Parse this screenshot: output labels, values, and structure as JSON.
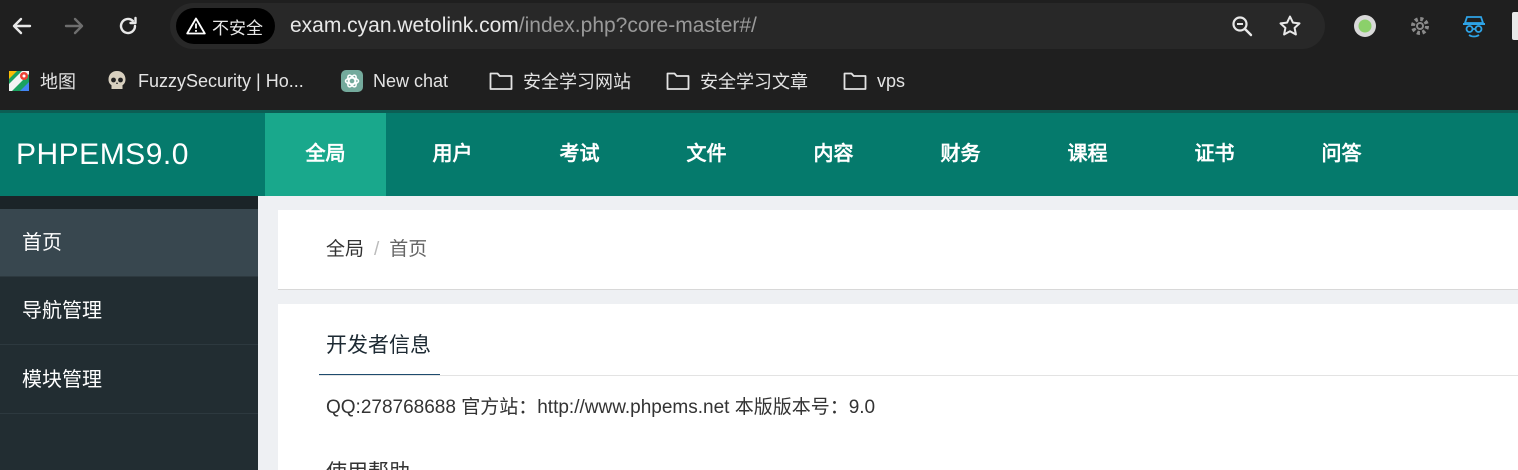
{
  "browser": {
    "security_label": "不安全",
    "url_host": "exam.cyan.wetolink.com",
    "url_rest": "/index.php?core-master#/"
  },
  "bookmarks": [
    {
      "label": "地图",
      "icon": "maps-icon"
    },
    {
      "label": "FuzzySecurity | Ho...",
      "icon": "skull-icon"
    },
    {
      "label": "New chat",
      "icon": "openai-icon"
    },
    {
      "label": "安全学习网站",
      "icon": "folder-icon"
    },
    {
      "label": "安全学习文章",
      "icon": "folder-icon"
    },
    {
      "label": "vps",
      "icon": "folder-icon"
    }
  ],
  "header": {
    "brand": "PHPEMS9.0",
    "menu": [
      "全局",
      "用户",
      "考试",
      "文件",
      "内容",
      "财务",
      "课程",
      "证书",
      "问答"
    ],
    "active_index": 0
  },
  "sidebar": {
    "items": [
      "首页",
      "导航管理",
      "模块管理"
    ],
    "active_index": 0
  },
  "breadcrumb": {
    "parent": "全局",
    "separator": "/",
    "current": "首页"
  },
  "panel": {
    "title": "开发者信息",
    "info": "QQ:278768688 官方站：http://www.phpems.net 本版版本号：9.0",
    "next_heading": "使用帮助"
  },
  "colors": {
    "header_bg": "#057a6c",
    "menu_active": "#19a88c",
    "sidebar_bg": "#222d32",
    "sidebar_active": "#38474f"
  }
}
